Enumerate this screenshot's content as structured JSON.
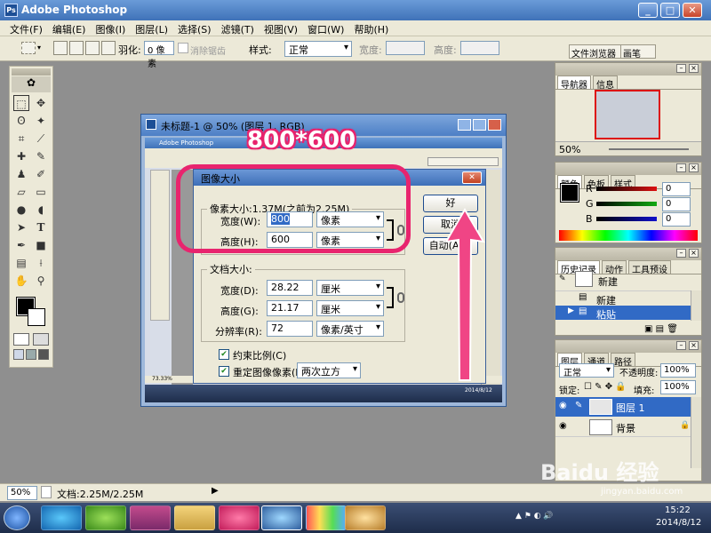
{
  "app": {
    "title": "Adobe Photoshop",
    "logo": "Ps"
  },
  "menu": [
    "文件(F)",
    "编辑(E)",
    "图像(I)",
    "图层(L)",
    "选择(S)",
    "滤镜(T)",
    "视图(V)",
    "窗口(W)",
    "帮助(H)"
  ],
  "options": {
    "feather_label": "羽化:",
    "feather_value": "0 像素",
    "antialias_label": "消除锯齿",
    "style_label": "样式:",
    "style_value": "正常",
    "width_label": "宽度:",
    "height_label": "高度:"
  },
  "palette_well": {
    "tab_browser": "文件浏览器",
    "tab_brush": "画笔"
  },
  "navigator": {
    "tabs": [
      "导航器",
      "信息"
    ],
    "zoom": "50%"
  },
  "color": {
    "tabs": [
      "颜色",
      "色板",
      "样式"
    ],
    "channels": [
      {
        "label": "R",
        "value": "0",
        "color": "#d11"
      },
      {
        "label": "G",
        "value": "0",
        "color": "#1a1"
      },
      {
        "label": "B",
        "value": "0",
        "color": "#11c"
      }
    ]
  },
  "history": {
    "tabs": [
      "历史记录",
      "动作",
      "工具预设"
    ],
    "snapshot": "新建",
    "items": [
      "新建",
      "粘贴"
    ]
  },
  "layers": {
    "tabs": [
      "图层",
      "通道",
      "路径"
    ],
    "blend_mode": "正常",
    "opacity_label": "不透明度:",
    "opacity_value": "100%",
    "lock_label": "锁定:",
    "fill_label": "填充:",
    "fill_value": "100%",
    "items": [
      "图层 1",
      "背景"
    ]
  },
  "document": {
    "title": "未标题-1 @ 50% (图层 1, RGB)",
    "zoom": "73.33%",
    "inner_app_title": "Adobe Photoshop"
  },
  "dialog": {
    "title": "图像大小",
    "pixel_group": "像素大小:1.37M(之前为2.25M)",
    "width_label": "宽度(W):",
    "width_value": "800",
    "height_label": "高度(H):",
    "height_value": "600",
    "pixel_unit": "像素",
    "doc_group": "文档大小:",
    "doc_width_label": "宽度(D):",
    "doc_width_value": "28.22",
    "doc_height_label": "高度(G):",
    "doc_height_value": "21.17",
    "doc_unit": "厘米",
    "res_label": "分辨率(R):",
    "res_value": "72",
    "res_unit": "像素/英寸",
    "constrain_label": "约束比例(C)",
    "resample_label": "重定图像像素(I):",
    "resample_value": "两次立方",
    "ok": "好",
    "cancel": "取消",
    "auto": "自动(A)..."
  },
  "annotation": {
    "text": "800*600",
    "color": "#e8246e"
  },
  "status": {
    "zoom": "50%",
    "doc": "文档:2.25M/2.25M"
  },
  "taskbar": {
    "time": "15:22",
    "date": "2014/8/12"
  },
  "watermark": {
    "brand": "Baidu 经验",
    "url": "jingyan.baidu.com"
  }
}
